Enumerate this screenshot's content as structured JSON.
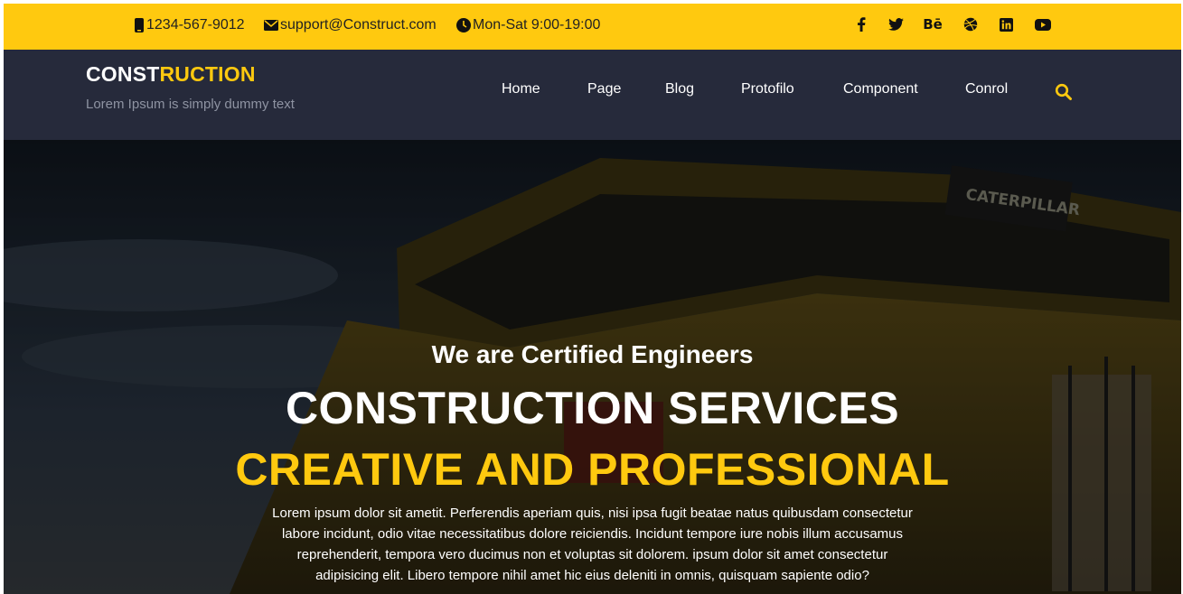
{
  "topbar": {
    "phone": "1234-567-9012",
    "email": "support@Construct.com",
    "hours": "Mon-Sat 9:00-19:00",
    "social": [
      "facebook-icon",
      "twitter-icon",
      "behance-icon",
      "dribbble-icon",
      "linkedin-icon",
      "youtube-icon"
    ],
    "behance_text": "Bē"
  },
  "header": {
    "logo_part1": "CONST",
    "logo_part2": "RUCTION",
    "tagline": "Lorem Ipsum is simply dummy text",
    "nav": [
      "Home",
      "Page",
      "Blog",
      "Protofilo",
      "Component",
      "Conrol"
    ]
  },
  "hero": {
    "subtitle": "We are Certified Engineers",
    "title": "CONSTRUCTION SERVICES",
    "title_accent": "CREATIVE AND PROFESSIONAL",
    "paragraph": "Lorem ipsum dolor sit ametit. Perferendis aperiam quis, nisi ipsa fugit beatae natus quibusdam consectetur labore incidunt, odio vitae necessitatibus dolore reiciendis. Incidunt tempore iure nobis illum accusamus reprehenderit, tempora vero ducimus non et voluptas sit dolorem. ipsum dolor sit amet consectetur adipisicing elit. Libero tempore nihil amet hic eius deleniti in omnis, quisquam sapiente odio?",
    "truck_brand": "CATERPILLAR"
  },
  "colors": {
    "accent": "#ffc90f",
    "header_bg": "#262a3b",
    "tagline": "#8e93a2"
  }
}
